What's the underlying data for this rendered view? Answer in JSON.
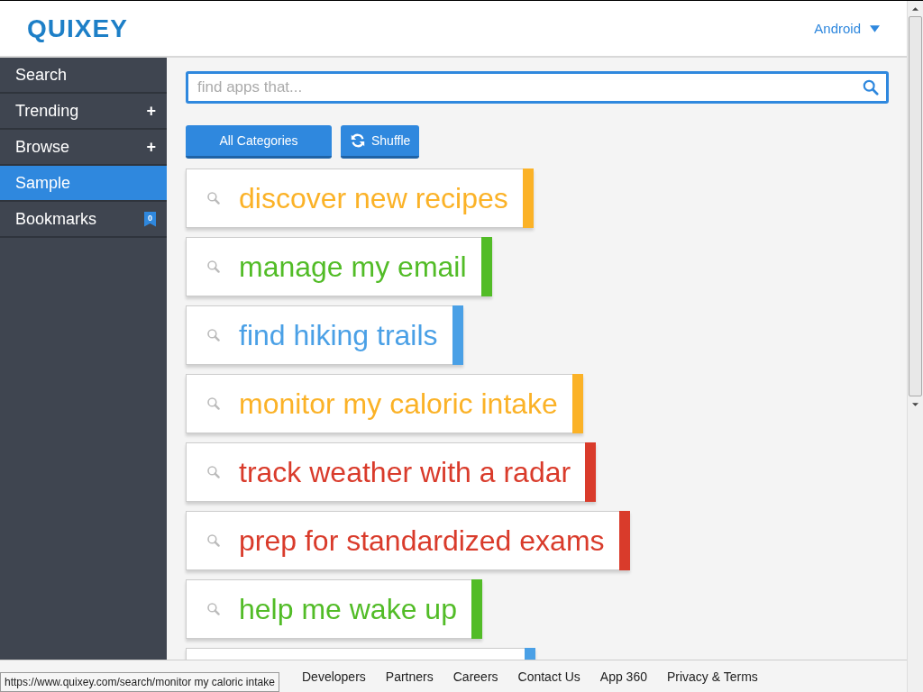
{
  "header": {
    "logo": "QUIXEY",
    "platform": "Android"
  },
  "sidebar": {
    "items": [
      {
        "label": "Search",
        "selected": false
      },
      {
        "label": "Trending",
        "selected": false,
        "expander": "+"
      },
      {
        "label": "Browse",
        "selected": false,
        "expander": "+"
      },
      {
        "label": "Sample",
        "selected": true
      },
      {
        "label": "Bookmarks",
        "selected": false,
        "badge": "0"
      }
    ]
  },
  "search": {
    "placeholder": "find apps that..."
  },
  "buttons": [
    {
      "label": "All Categories",
      "kind": "plain"
    },
    {
      "label": "Shuffle",
      "kind": "shuffle"
    }
  ],
  "suggestions": [
    {
      "text": "discover new recipes",
      "color": "#fbb227"
    },
    {
      "text": "manage my email",
      "color": "#52bc27"
    },
    {
      "text": "find hiking trails",
      "color": "#4aa0e6"
    },
    {
      "text": "monitor my caloric intake",
      "color": "#fbb227"
    },
    {
      "text": "track weather with a radar",
      "color": "#d93b2b"
    },
    {
      "text": "prep for standardized exams",
      "color": "#d93b2b"
    },
    {
      "text": "help me wake up",
      "color": "#52bc27"
    },
    {
      "color": "#4aa0e6"
    }
  ],
  "footer": {
    "links": [
      "Developers",
      "Partners",
      "Careers",
      "Contact Us",
      "App 360",
      "Privacy & Terms"
    ]
  },
  "status_url": "https://www.quixey.com/search/monitor my caloric intake"
}
